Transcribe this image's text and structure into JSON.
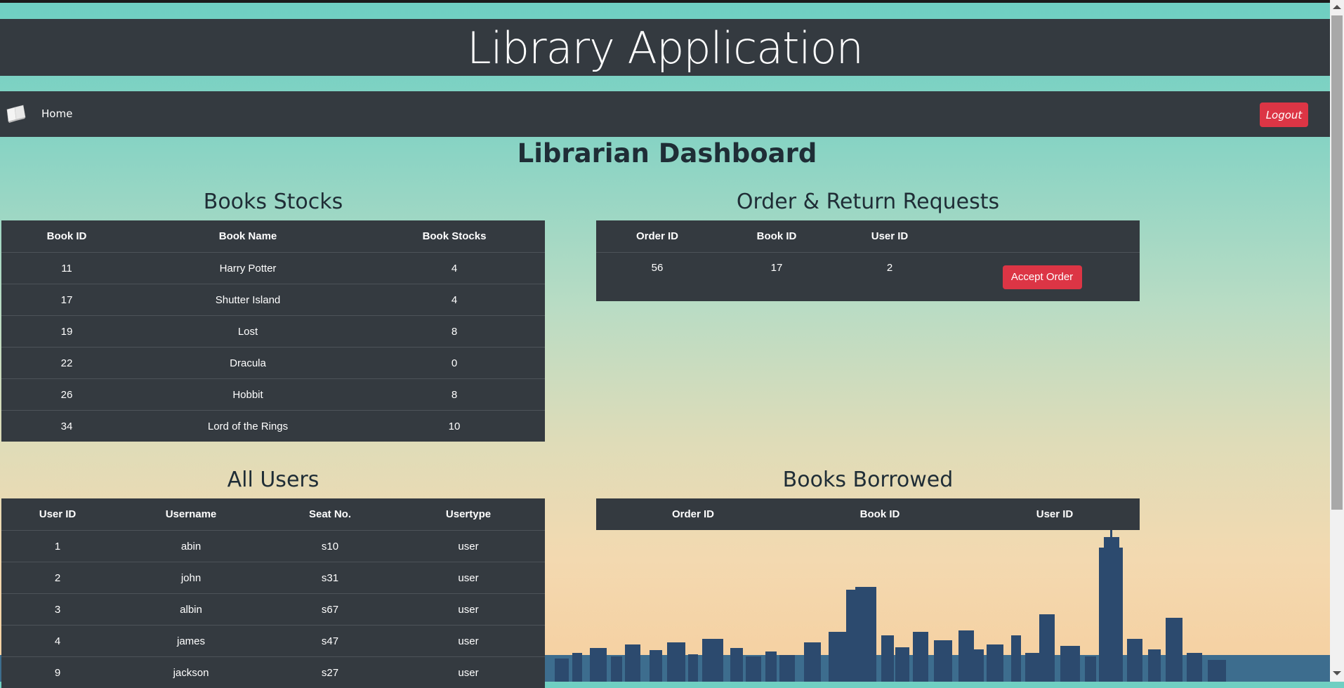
{
  "app": {
    "title": "Library Application"
  },
  "nav": {
    "home": "Home",
    "logout": "Logout"
  },
  "dashboard": {
    "title": "Librarian Dashboard"
  },
  "books_stocks": {
    "title": "Books Stocks",
    "headers": [
      "Book ID",
      "Book Name",
      "Book Stocks"
    ],
    "rows": [
      [
        "11",
        "Harry Potter",
        "4"
      ],
      [
        "17",
        "Shutter Island",
        "4"
      ],
      [
        "19",
        "Lost",
        "8"
      ],
      [
        "22",
        "Dracula",
        "0"
      ],
      [
        "26",
        "Hobbit",
        "8"
      ],
      [
        "34",
        "Lord of the Rings",
        "10"
      ]
    ]
  },
  "requests": {
    "title": "Order & Return Requests",
    "headers": [
      "Order ID",
      "Book ID",
      "User ID",
      ""
    ],
    "rows": [
      {
        "order_id": "56",
        "book_id": "17",
        "user_id": "2",
        "action": "Accept Order"
      }
    ]
  },
  "users": {
    "title": "All Users",
    "headers": [
      "User ID",
      "Username",
      "Seat No.",
      "Usertype"
    ],
    "rows": [
      [
        "1",
        "abin",
        "s10",
        "user"
      ],
      [
        "2",
        "john",
        "s31",
        "user"
      ],
      [
        "3",
        "albin",
        "s67",
        "user"
      ],
      [
        "4",
        "james",
        "s47",
        "user"
      ],
      [
        "9",
        "jackson",
        "s27",
        "user"
      ]
    ]
  },
  "borrowed": {
    "title": "Books Borrowed",
    "headers": [
      "Order ID",
      "Book ID",
      "User ID"
    ]
  },
  "colors": {
    "dark": "#343a40",
    "danger": "#dc3545"
  },
  "icons": {
    "brand": "open-book-icon"
  }
}
